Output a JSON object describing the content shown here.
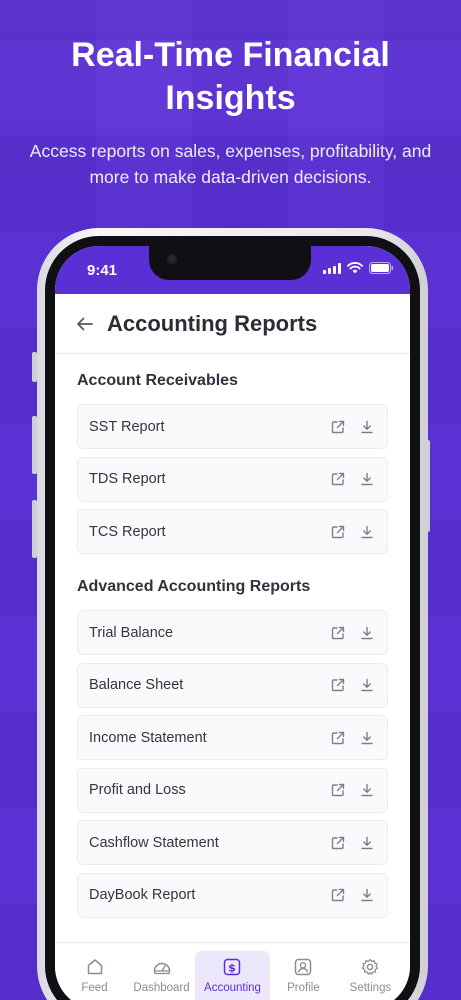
{
  "promo": {
    "headline": "Real-Time Financial Insights",
    "subline": "Access reports on sales, expenses, profitability, and more to make data-driven decisions."
  },
  "status_bar": {
    "time": "9:41"
  },
  "header": {
    "title": "Accounting Reports"
  },
  "sections": [
    {
      "title": "Account Receivables",
      "items": [
        "SST Report",
        "TDS Report",
        "TCS Report"
      ]
    },
    {
      "title": "Advanced Accounting Reports",
      "items": [
        "Trial Balance",
        "Balance Sheet",
        "Income Statement",
        "Profit and Loss",
        "Cashflow Statement",
        "DayBook Report"
      ]
    }
  ],
  "tabs": [
    {
      "label": "Feed",
      "icon": "home-icon"
    },
    {
      "label": "Dashboard",
      "icon": "gauge-icon"
    },
    {
      "label": "Accounting",
      "icon": "dollar-square-icon",
      "active": true
    },
    {
      "label": "Profile",
      "icon": "user-icon"
    },
    {
      "label": "Settings",
      "icon": "gear-icon"
    }
  ],
  "colors": {
    "brand": "#5a2fd6",
    "active_tab_bg": "#ece7fb"
  }
}
